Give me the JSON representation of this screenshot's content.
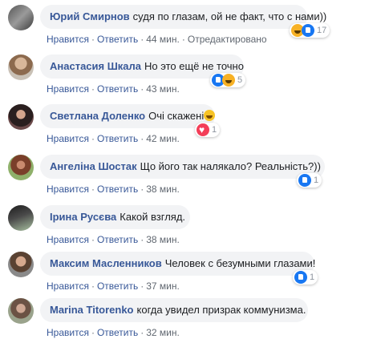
{
  "actions": {
    "like": "Нравится",
    "reply": "Ответить",
    "separator": "·",
    "edited": "Отредактировано"
  },
  "comments": [
    {
      "author": "Юрий Смирнов",
      "text": "судя по глазам, ой не факт, что с нами))",
      "time": "44 мин.",
      "reactions": {
        "icons": [
          "haha-icon",
          "like-icon"
        ],
        "count": "17"
      }
    },
    {
      "author": "Анастасия Шкала",
      "text": "Но это ещё не точно",
      "time": "43 мин.",
      "reactions": {
        "icons": [
          "like-icon",
          "haha-icon"
        ],
        "count": "5"
      }
    },
    {
      "author": "Светлана Доленко",
      "text": "Очі скажені",
      "time": "42 мин.",
      "reactions": {
        "icons": [
          "love-icon"
        ],
        "count": "1"
      }
    },
    {
      "author": "Ангеліна Шостак",
      "text": "Що його так налякало? Реальність?))",
      "time": "38 мин.",
      "reactions": {
        "icons": [
          "like-icon"
        ],
        "count": "1"
      }
    },
    {
      "author": "Ірина Русєва",
      "text": "Какой взгляд.",
      "time": "38 мин."
    },
    {
      "author": "Максим Масленников",
      "text": "Человек с безумными глазами!",
      "time": "37 мин.",
      "reactions": {
        "icons": [
          "like-icon"
        ],
        "count": "1"
      }
    },
    {
      "author": "Marina Titorenko",
      "text": "когда увидел призрак коммунизма.",
      "time": "32 мин."
    }
  ],
  "colors": {
    "author": "#385898",
    "bubble": "#f2f3f5",
    "meta": "#606770",
    "like": "#1877f2",
    "haha": "#f7b125",
    "love": "#f33e58"
  }
}
